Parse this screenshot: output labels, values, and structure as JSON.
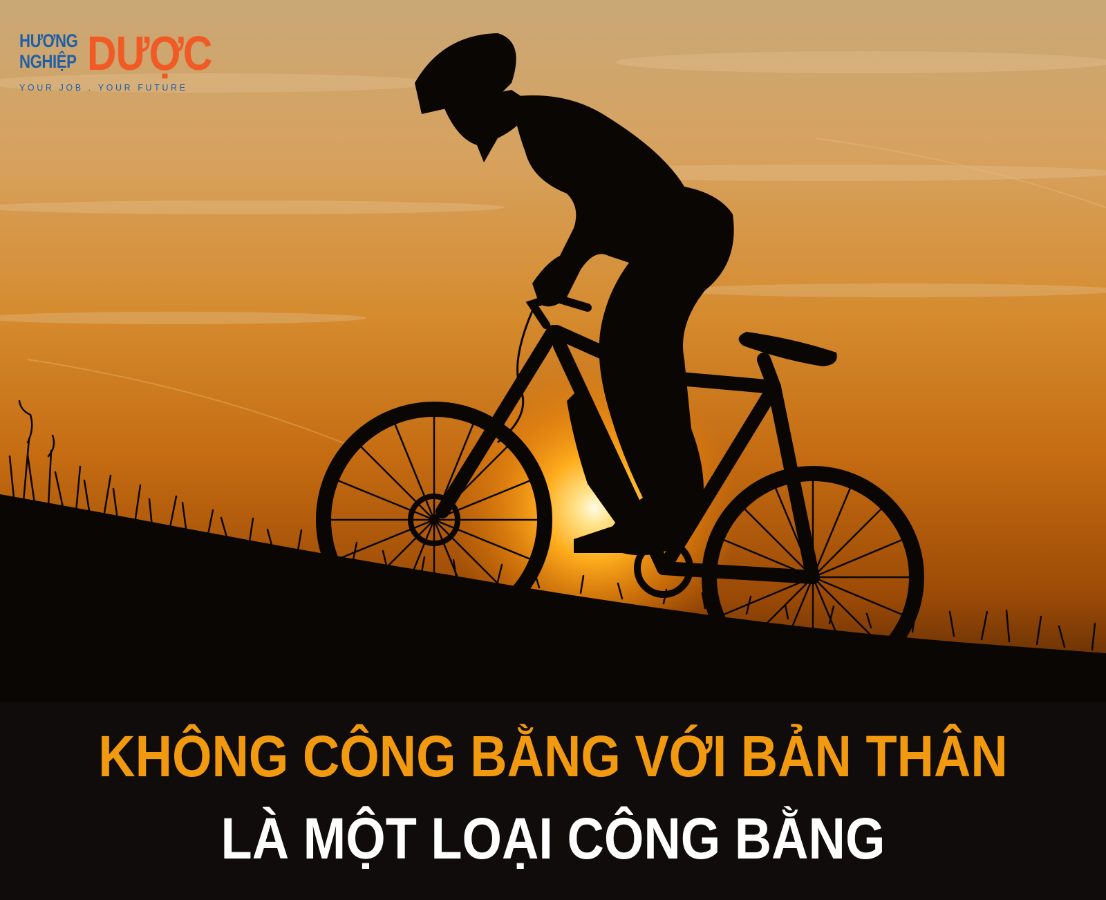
{
  "logo": {
    "word1": "HƯƠNG",
    "word2": "NGHIỆP",
    "word3": "DƯỢC",
    "tagline": "YOUR JOB . YOUR FUTURE",
    "colors": {
      "blue": "#1f5fa8",
      "orange": "#f15a24"
    }
  },
  "photo": {
    "subject": "cyclist-silhouette-at-sunset"
  },
  "caption": {
    "line1": "KHÔNG CÔNG BẰNG VỚI BẢN THÂN",
    "line2": "LÀ MỘT LOẠI CÔNG BẰNG",
    "colors": {
      "line1": "#f29a0f",
      "line2": "#ffffff",
      "background": "#0f0c0b"
    }
  }
}
